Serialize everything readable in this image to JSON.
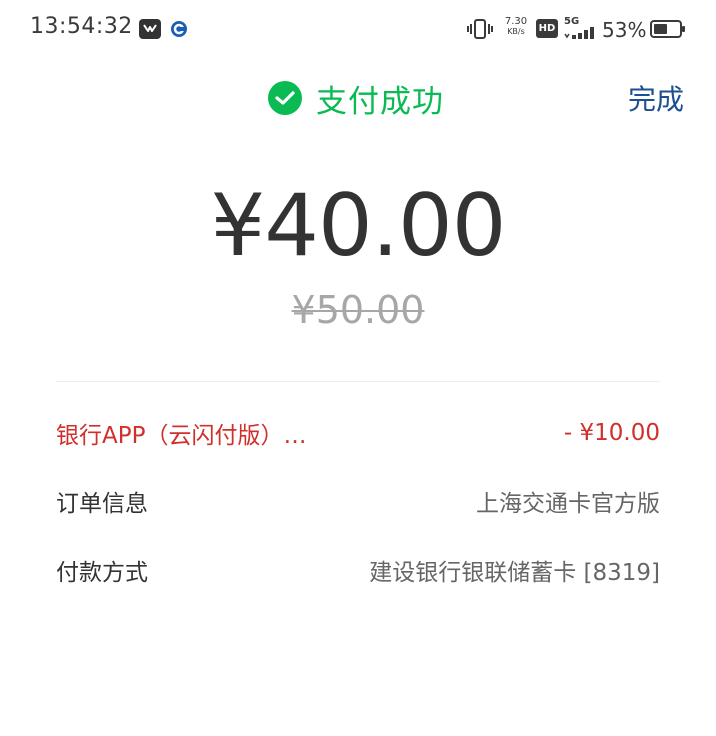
{
  "status_bar": {
    "time": "13:54:32",
    "net_speed_value": "7.30",
    "net_speed_unit": "KB/s",
    "hd_label": "HD",
    "network_label": "5G",
    "battery_percent": "53%",
    "icons": [
      "message-app-icon",
      "bank-app-icon",
      "vibrate-icon",
      "hd-icon",
      "signal-icon",
      "battery-icon"
    ]
  },
  "header": {
    "success_text": "支付成功",
    "done_label": "完成"
  },
  "amount": {
    "paid": "¥40.00",
    "original": "¥50.00"
  },
  "details": {
    "discount": {
      "label": "银行APP（云闪付版）…",
      "value": "- ¥10.00"
    },
    "order": {
      "label": "订单信息",
      "value": "上海交通卡官方版"
    },
    "payment": {
      "label": "付款方式",
      "value": "建设银行银联储蓄卡 [8319]"
    }
  },
  "colors": {
    "success_green": "#09bb52",
    "link_blue": "#1d4f91",
    "discount_red": "#d0302b"
  }
}
